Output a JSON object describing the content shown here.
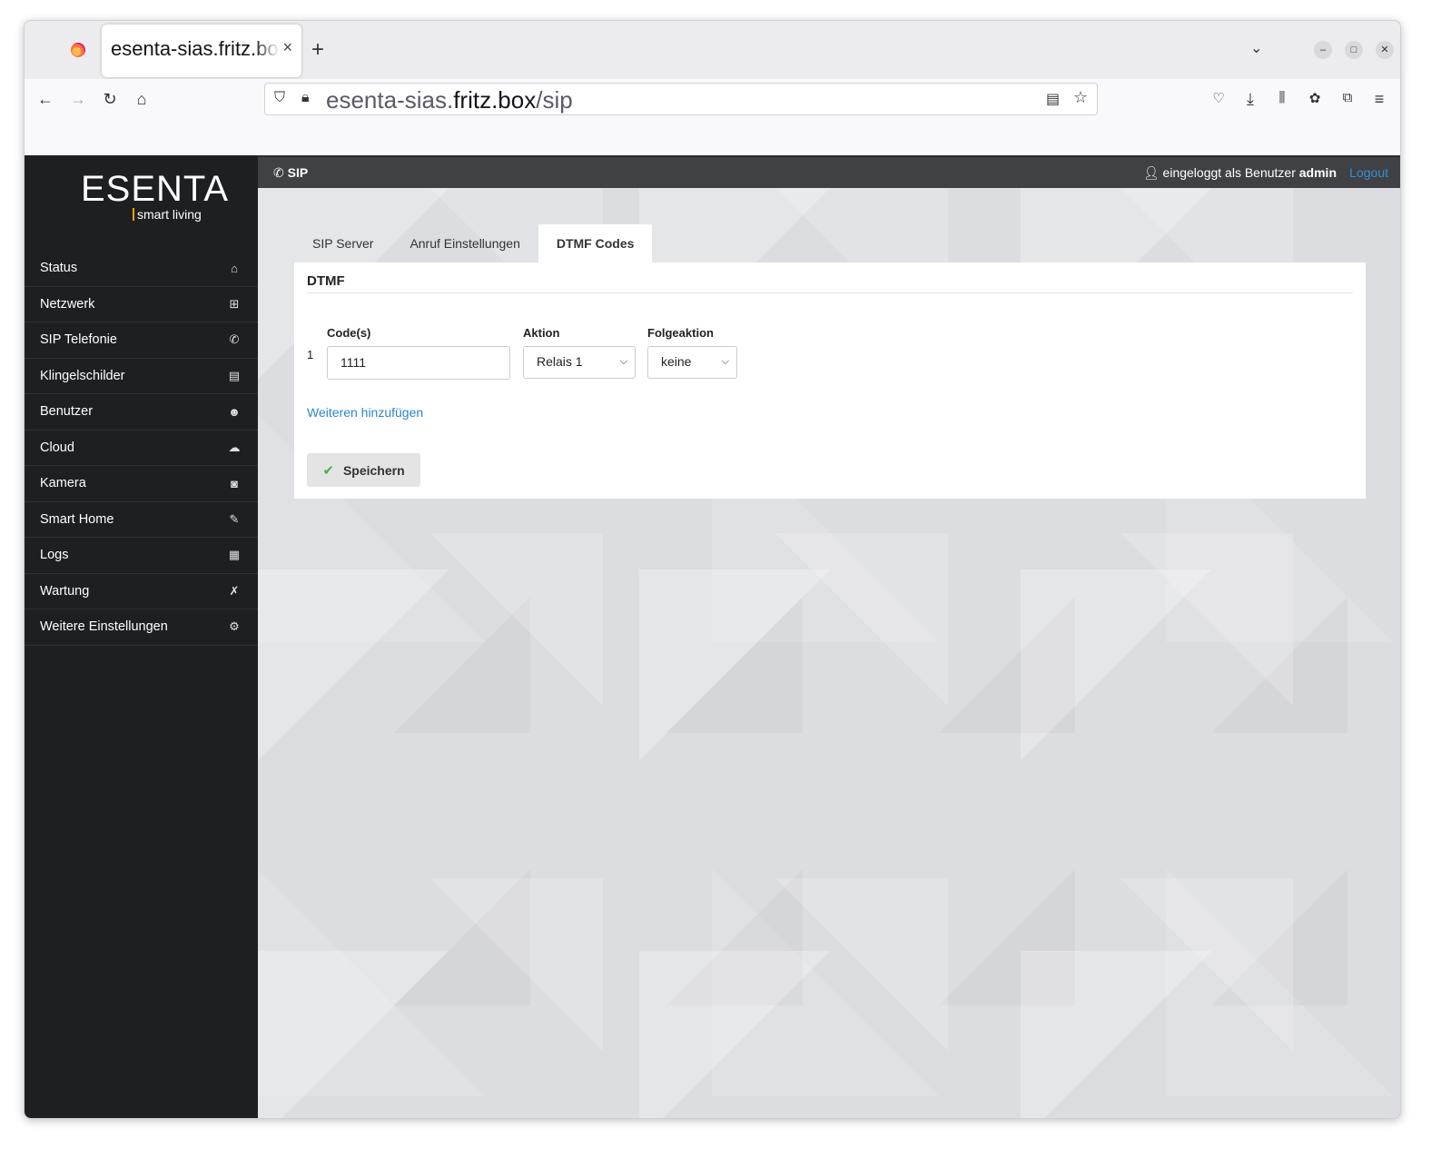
{
  "browser": {
    "tab_title": "esenta-sias.fritz.box/sip",
    "tab_close": "×",
    "new_tab": "+",
    "url_host_pre": "esenta-sias.",
    "url_host_main": "fritz.box",
    "url_path": "/sip"
  },
  "app": {
    "logo_main": "ESENTA",
    "logo_sub": "smart living",
    "menu": [
      {
        "label": "Status",
        "icon": "home-icon",
        "glyph": "⌂"
      },
      {
        "label": "Netzwerk",
        "icon": "sitemap-icon",
        "glyph": "⊞"
      },
      {
        "label": "SIP Telefonie",
        "icon": "phone-icon",
        "glyph": "✆"
      },
      {
        "label": "Klingelschilder",
        "icon": "book-icon",
        "glyph": "▤"
      },
      {
        "label": "Benutzer",
        "icon": "users-icon",
        "glyph": "☻"
      },
      {
        "label": "Cloud",
        "icon": "cloud-icon",
        "glyph": "☁"
      },
      {
        "label": "Kamera",
        "icon": "camera-icon",
        "glyph": "◙"
      },
      {
        "label": "Smart Home",
        "icon": "magic-icon",
        "glyph": "✎"
      },
      {
        "label": "Logs",
        "icon": "calendar-icon",
        "glyph": "▦"
      },
      {
        "label": "Wartung",
        "icon": "wrench-icon",
        "glyph": "✗"
      },
      {
        "label": "Weitere Einstellungen",
        "icon": "gears-icon",
        "glyph": "⚙"
      }
    ],
    "topbar": {
      "title": "SIP",
      "user_prefix": "eingeloggt als Benutzer",
      "user_name": "admin",
      "logout": "Logout"
    },
    "tabs": [
      "SIP Server",
      "Anruf Einstellungen",
      "DTMF Codes"
    ],
    "active_tab": 2,
    "panel": {
      "title": "DTMF",
      "labels": {
        "codes": "Code(s)",
        "action": "Aktion",
        "follow": "Folgeaktion"
      },
      "row": {
        "num": "1",
        "code": "1111",
        "action": "Relais 1",
        "follow": "keine"
      },
      "add_link": "Weiteren hinzufügen",
      "save": "Speichern"
    }
  }
}
